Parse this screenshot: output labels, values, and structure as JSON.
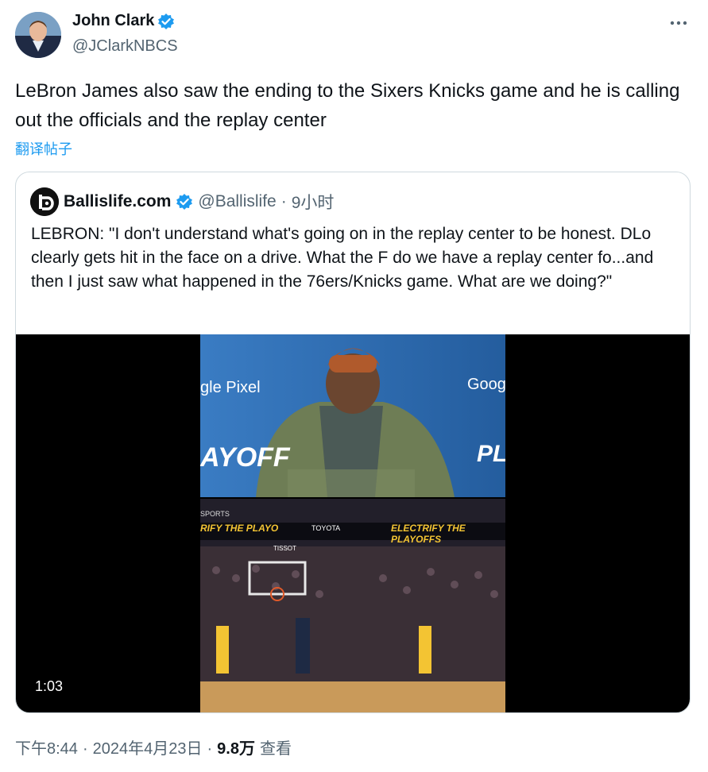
{
  "author": {
    "name": "John Clark",
    "handle": "@JClarkNBCS",
    "verified_icon": "verified-badge-icon",
    "accent": "#1d9bf0"
  },
  "tweet": {
    "text": "LeBron James also saw the ending to the Sixers Knicks game and he is calling out the officials and the replay center",
    "translate_label": "翻译帖子"
  },
  "quoted": {
    "name": "Ballislife.com",
    "handle": "@Ballislife",
    "separator": "·",
    "time": "9小时",
    "text": "LEBRON: \"I don't understand what's going on in the replay center to be honest. DLo clearly gets hit in the face on a drive. What the F do we have a replay center fo...and then I just saw what happened in the 76ers/Knicks game. What are we doing?\"",
    "video_duration": "1:03",
    "video_overlay": {
      "sponsor_left": "gle Pixel",
      "banner_right": "Goog",
      "playoffs_text": "AYOFF",
      "nba_text": "PLA",
      "scoreboard_left": "RIFY THE PLAYO",
      "scoreboard_right": "ELECTRIFY THE PLAYOFFS",
      "toyota": "TOYOTA",
      "sports": "SPORTS",
      "tissot": "TISSOT"
    }
  },
  "footer": {
    "time": "下午8:44",
    "dot1": "·",
    "date": "2024年4月23日",
    "dot2": "·",
    "views_count": "9.8万",
    "views_label": "查看"
  }
}
